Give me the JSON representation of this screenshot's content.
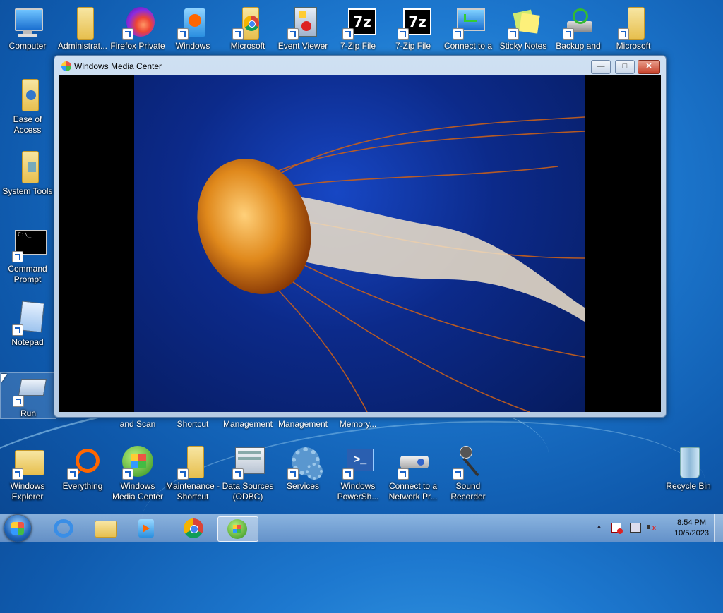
{
  "desktop": {
    "top_icons": [
      {
        "label": "Computer",
        "icon": "computer-icon"
      },
      {
        "label": "Administrat...",
        "icon": "folder-icon"
      },
      {
        "label": "Firefox Private",
        "icon": "firefox-private-icon"
      },
      {
        "label": "Windows",
        "icon": "media-player-icon"
      },
      {
        "label": "Microsoft",
        "icon": "chrome-folder-icon"
      },
      {
        "label": "Event Viewer",
        "icon": "event-viewer-icon"
      },
      {
        "label": "7-Zip File",
        "icon": "7zip-icon"
      },
      {
        "label": "7-Zip File",
        "icon": "7zip-icon"
      },
      {
        "label": "Connect to a",
        "icon": "remote-desktop-icon"
      },
      {
        "label": "Sticky Notes",
        "icon": "sticky-notes-icon"
      },
      {
        "label": "Backup and",
        "icon": "backup-icon"
      },
      {
        "label": "Microsoft",
        "icon": "folder-icon"
      }
    ],
    "left_icons": [
      {
        "label": "Ease of Access",
        "icon": "ease-of-access-folder-icon"
      },
      {
        "label": "System Tools",
        "icon": "system-tools-folder-icon"
      },
      {
        "label": "Command Prompt",
        "icon": "command-prompt-icon"
      },
      {
        "label": "Notepad",
        "icon": "notepad-icon"
      },
      {
        "label": "Run",
        "icon": "run-icon"
      }
    ],
    "partial_labels": [
      "and Scan",
      "Shortcut",
      "Management",
      "Management",
      "Memory..."
    ],
    "bottom_icons": [
      {
        "label": "Windows Explorer",
        "icon": "windows-explorer-icon"
      },
      {
        "label": "Everything",
        "icon": "everything-search-icon"
      },
      {
        "label": "Windows Media Center",
        "icon": "media-center-icon"
      },
      {
        "label": "Maintenance - Shortcut",
        "icon": "maintenance-folder-icon"
      },
      {
        "label": "Data Sources (ODBC)",
        "icon": "odbc-icon"
      },
      {
        "label": "Services",
        "icon": "services-gear-icon"
      },
      {
        "label": "Windows PowerSh...",
        "icon": "powershell-icon"
      },
      {
        "label": "Connect to a Network Pr...",
        "icon": "network-projector-icon"
      },
      {
        "label": "Sound Recorder",
        "icon": "microphone-icon"
      }
    ],
    "recycle_bin": {
      "label": "Recycle Bin",
      "icon": "recycle-bin-icon"
    }
  },
  "window": {
    "title": "Windows Media Center",
    "minimize": "—",
    "maximize": "□",
    "close": "✕"
  },
  "taskbar": {
    "start": "start-orb-icon",
    "pinned": [
      "internet-explorer-icon",
      "windows-explorer-icon",
      "media-player-icon",
      "chrome-icon",
      "media-center-icon"
    ],
    "time": "8:54 PM",
    "date": "10/5/2023",
    "tray_arrow": "▲"
  }
}
